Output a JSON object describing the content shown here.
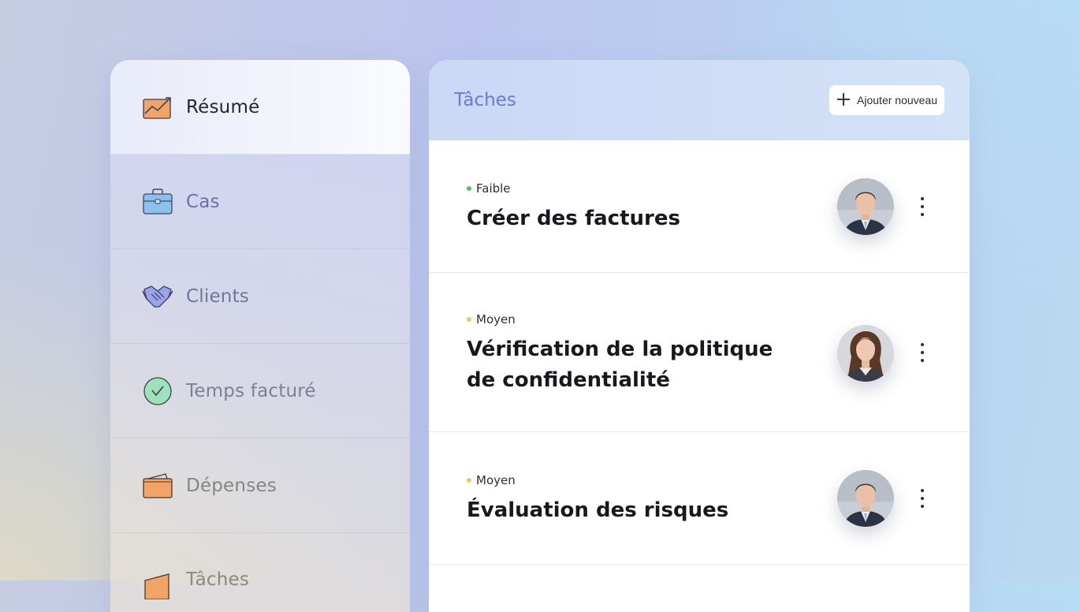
{
  "sidebar": {
    "items": [
      {
        "label": "Résumé",
        "icon": "chart-trend-icon",
        "active": true
      },
      {
        "label": "Cas",
        "icon": "briefcase-icon",
        "active": false
      },
      {
        "label": "Clients",
        "icon": "handshake-icon",
        "active": false
      },
      {
        "label": "Temps facturé",
        "icon": "clock-check-icon",
        "active": false
      },
      {
        "label": "Dépenses",
        "icon": "wallet-icon",
        "active": false
      },
      {
        "label": "Tâches",
        "icon": "tasks-folder-icon",
        "active": false
      }
    ]
  },
  "tasks_panel": {
    "title": "Tâches",
    "add_button_label": "Ajouter nouveau",
    "tasks": [
      {
        "priority": "Faible",
        "priority_color": "#5cbf6f",
        "title": "Créer des factures",
        "assignee": "man-avatar"
      },
      {
        "priority": "Moyen",
        "priority_color": "#f2c55b",
        "title": "Vérification de la politique de confidentialité",
        "assignee": "woman-avatar"
      },
      {
        "priority": "Moyen",
        "priority_color": "#f2c55b",
        "title": "Évaluation des risques",
        "assignee": "man-avatar"
      }
    ]
  },
  "colors": {
    "accent": "#6c79d3",
    "header_bg": "#cfdcf6",
    "priority_low": "#5cbf6f",
    "priority_medium": "#f2c55b"
  }
}
